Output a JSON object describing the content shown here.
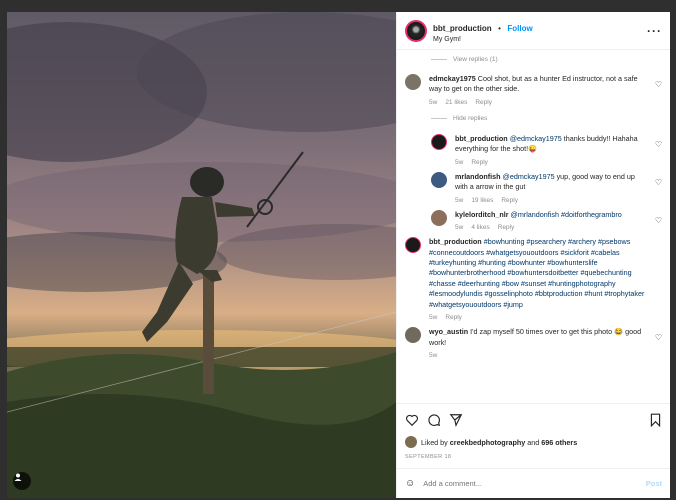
{
  "header": {
    "username": "bbt_production",
    "follow_label": "Follow",
    "location": "My Gym!"
  },
  "comments": {
    "view_replies": "View replies (1)",
    "hide_replies": "Hide replies",
    "items": [
      {
        "user": "edmckay1975",
        "text": "Cool shot, but as a hunter Ed instructor, not a safe way to get on the other side.",
        "age": "5w",
        "likes": "21 likes",
        "reply": "Reply"
      },
      {
        "user": "bbt_production",
        "mention": "@edmckay1975",
        "text": "thanks buddy!! Hahaha everything for the shot!😜",
        "age": "5w",
        "reply": "Reply"
      },
      {
        "user": "mrlandonfish",
        "mention": "@edmckay1975",
        "text": "yup, good way to end up with a arrow in the gut",
        "age": "5w",
        "likes": "19 likes",
        "reply": "Reply"
      },
      {
        "user": "kylelorditch_nlr",
        "mention": "@mrlandonfish",
        "text": "#doitforthegrambro",
        "age": "5w",
        "likes": "4 likes",
        "reply": "Reply"
      },
      {
        "user": "bbt_production",
        "text": "#bowhunting #psearchery #archery #psebows #connecoutdoors #whatgetsyououtdoors #sickforit #cabelas #turkeyhunting #hunting #bowhunter #bowhunterslife #bowhunterbrotherhood #bowhuntersdoitbetter #quebechunting #chasse #deerhunting #bow #sunset #huntingphotography #lesmoodylundis #gosselinphoto #bbtproduction #hunt #trophytaker #whatgetsyououtdoors #jump",
        "age": "5w",
        "reply": "Reply"
      },
      {
        "user": "wyo_austin",
        "text": "I'd zap myself 50 times over to get this photo 😂 good work!",
        "age": "5w"
      }
    ]
  },
  "likes": {
    "prefix": "Liked by",
    "user": "creekbedphotography",
    "and": "and",
    "others": "696 others"
  },
  "date": "SEPTEMBER 18",
  "add_comment": {
    "placeholder": "Add a comment...",
    "post_label": "Post"
  },
  "colors": {
    "accent": "#0095f6",
    "text": "#262626",
    "muted": "#8e8e8e"
  }
}
